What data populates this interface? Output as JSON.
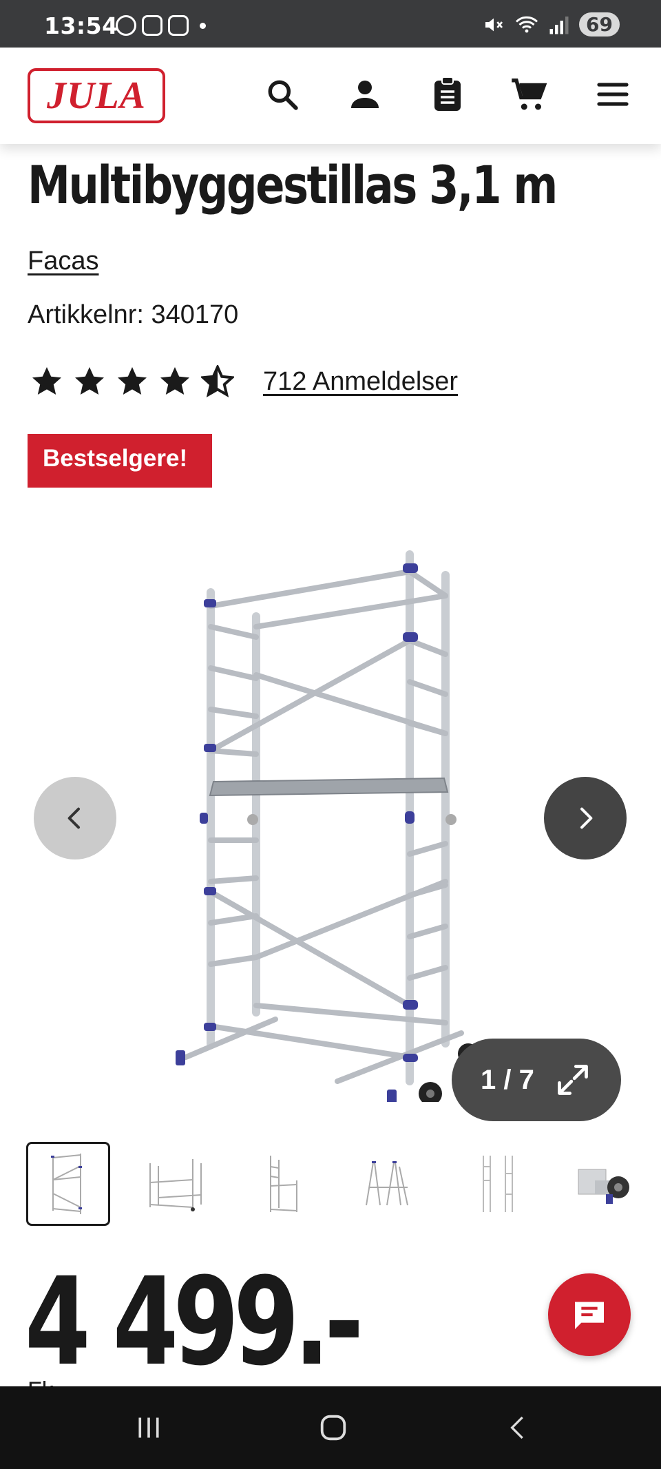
{
  "status_bar": {
    "time": "13:54",
    "battery": "69"
  },
  "header": {
    "logo_text": "JULA"
  },
  "product": {
    "title": "Multibyggestillas 3,1 m",
    "brand": "Facas",
    "article_number": "Artikkelnr: 340170",
    "rating": 4.5,
    "reviews": "712 Anmeldelser",
    "badge": "Bestselgere!",
    "price": "4 499.-",
    "cut_text": "Fk"
  },
  "gallery": {
    "counter": "1 / 7",
    "current_image": 1,
    "total_images": 7,
    "thumbnail_count": 6
  },
  "colors": {
    "brand_red": "#d0202e",
    "status_bar": "#3a3b3d",
    "nav_bar": "#121212"
  }
}
